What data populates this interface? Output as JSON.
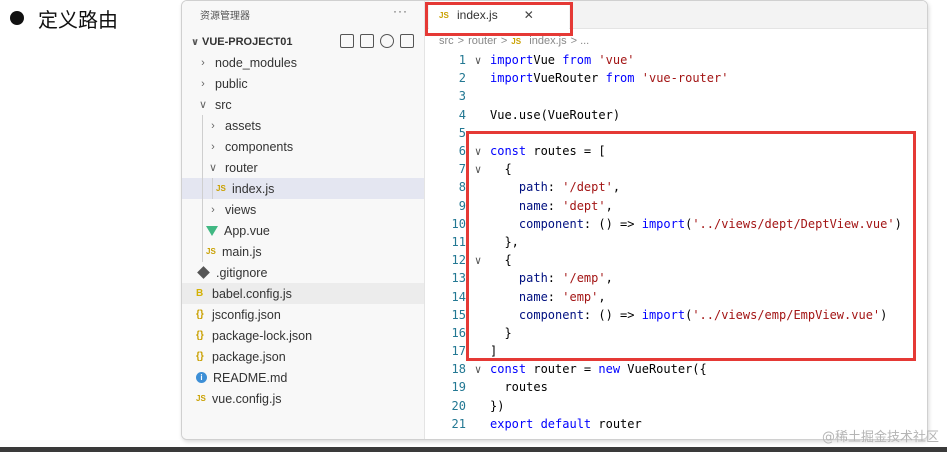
{
  "slide": {
    "bullet": "●",
    "heading": "定义路由"
  },
  "explorer": {
    "title": "资源管理器",
    "more": "···",
    "project": "VUE-PROJECT01",
    "items": [
      {
        "label": "node_modules",
        "type": "folder",
        "expanded": false,
        "depth": 0
      },
      {
        "label": "public",
        "type": "folder",
        "expanded": false,
        "depth": 0
      },
      {
        "label": "src",
        "type": "folder",
        "expanded": true,
        "depth": 0
      },
      {
        "label": "assets",
        "type": "folder",
        "expanded": false,
        "depth": 1
      },
      {
        "label": "components",
        "type": "folder",
        "expanded": false,
        "depth": 1
      },
      {
        "label": "router",
        "type": "folder",
        "expanded": true,
        "depth": 1
      },
      {
        "label": "index.js",
        "type": "js",
        "depth": 2,
        "selected": true
      },
      {
        "label": "views",
        "type": "folder",
        "expanded": false,
        "depth": 1
      },
      {
        "label": "App.vue",
        "type": "vue",
        "depth": 1
      },
      {
        "label": "main.js",
        "type": "js",
        "depth": 1
      },
      {
        "label": ".gitignore",
        "type": "git",
        "depth": 0
      },
      {
        "label": "babel.config.js",
        "type": "babel",
        "depth": 0,
        "hover": true
      },
      {
        "label": "jsconfig.json",
        "type": "json",
        "depth": 0
      },
      {
        "label": "package-lock.json",
        "type": "json",
        "depth": 0
      },
      {
        "label": "package.json",
        "type": "json",
        "depth": 0
      },
      {
        "label": "README.md",
        "type": "info",
        "depth": 0
      },
      {
        "label": "vue.config.js",
        "type": "js",
        "depth": 0
      }
    ]
  },
  "editor": {
    "tab": {
      "icon": "JS",
      "label": "index.js",
      "close": "✕"
    },
    "breadcrumb": [
      "src",
      ">",
      "router",
      ">",
      "JS",
      "index.js",
      "> ..."
    ],
    "lines": [
      {
        "n": "1",
        "fold": "∨",
        "tokens": [
          [
            "kw",
            "import"
          ],
          [
            "",
            "Vue "
          ],
          [
            "kw",
            "from"
          ],
          [
            "str",
            " 'vue'"
          ]
        ]
      },
      {
        "n": "2",
        "fold": "",
        "tokens": [
          [
            "kw",
            "import"
          ],
          [
            "",
            "VueRouter "
          ],
          [
            "kw",
            "from"
          ],
          [
            "str",
            " 'vue-router'"
          ]
        ]
      },
      {
        "n": "3",
        "fold": "",
        "tokens": []
      },
      {
        "n": "4",
        "fold": "",
        "tokens": [
          [
            "",
            "Vue.use(VueRouter)"
          ]
        ]
      },
      {
        "n": "5",
        "fold": "",
        "tokens": []
      },
      {
        "n": "6",
        "fold": "∨",
        "tokens": [
          [
            "kw",
            "const"
          ],
          [
            "",
            " routes = ["
          ]
        ]
      },
      {
        "n": "7",
        "fold": "∨",
        "tokens": [
          [
            "",
            "  {"
          ]
        ]
      },
      {
        "n": "8",
        "fold": "",
        "tokens": [
          [
            "prop",
            "    path"
          ],
          [
            "",
            ": "
          ],
          [
            "str",
            "'/dept'"
          ],
          [
            "",
            ","
          ]
        ]
      },
      {
        "n": "9",
        "fold": "",
        "tokens": [
          [
            "prop",
            "    name"
          ],
          [
            "",
            ": "
          ],
          [
            "str",
            "'dept'"
          ],
          [
            "",
            ","
          ]
        ]
      },
      {
        "n": "10",
        "fold": "",
        "tokens": [
          [
            "prop",
            "    component"
          ],
          [
            "",
            ": () => "
          ],
          [
            "kw",
            "import"
          ],
          [
            "",
            "("
          ],
          [
            "str",
            "'../views/dept/DeptView.vue'"
          ],
          [
            "",
            ")"
          ]
        ]
      },
      {
        "n": "11",
        "fold": "",
        "tokens": [
          [
            "",
            "  },"
          ]
        ]
      },
      {
        "n": "12",
        "fold": "∨",
        "tokens": [
          [
            "",
            "  {"
          ]
        ]
      },
      {
        "n": "13",
        "fold": "",
        "tokens": [
          [
            "prop",
            "    path"
          ],
          [
            "",
            ": "
          ],
          [
            "str",
            "'/emp'"
          ],
          [
            "",
            ","
          ]
        ]
      },
      {
        "n": "14",
        "fold": "",
        "tokens": [
          [
            "prop",
            "    name"
          ],
          [
            "",
            ": "
          ],
          [
            "str",
            "'emp'"
          ],
          [
            "",
            ","
          ]
        ]
      },
      {
        "n": "15",
        "fold": "",
        "tokens": [
          [
            "prop",
            "    component"
          ],
          [
            "",
            ": () => "
          ],
          [
            "kw",
            "import"
          ],
          [
            "",
            "("
          ],
          [
            "str",
            "'../views/emp/EmpView.vue'"
          ],
          [
            "",
            ")"
          ]
        ]
      },
      {
        "n": "16",
        "fold": "",
        "tokens": [
          [
            "",
            "  }"
          ]
        ]
      },
      {
        "n": "17",
        "fold": "",
        "tokens": [
          [
            "",
            "]"
          ]
        ]
      },
      {
        "n": "18",
        "fold": "∨",
        "tokens": [
          [
            "kw",
            "const"
          ],
          [
            "",
            " router = "
          ],
          [
            "kw",
            "new"
          ],
          [
            "",
            " VueRouter({"
          ]
        ]
      },
      {
        "n": "19",
        "fold": "",
        "tokens": [
          [
            "",
            "  routes"
          ]
        ]
      },
      {
        "n": "20",
        "fold": "",
        "tokens": [
          [
            "",
            "})"
          ]
        ]
      },
      {
        "n": "21",
        "fold": "",
        "tokens": [
          [
            "kw",
            "export default"
          ],
          [
            "",
            " router"
          ]
        ]
      }
    ]
  },
  "watermark": "@稀土掘金技术社区",
  "colors": {
    "highlight": "#e53935",
    "keyword": "#0000ff",
    "string": "#a31515",
    "property": "#001080"
  }
}
